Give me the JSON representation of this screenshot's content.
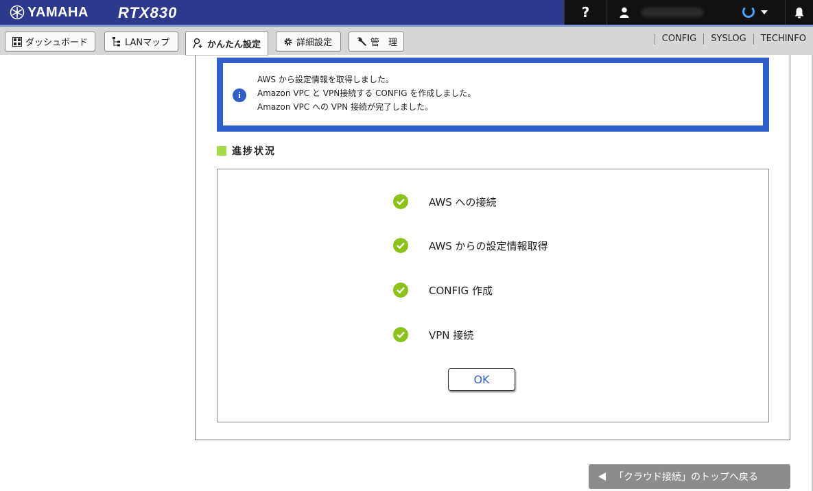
{
  "header": {
    "brand": "YAMAHA",
    "model": "RTX830",
    "help_label": "?",
    "colors": {
      "bar": "#2d3a8c",
      "right_area": "#111111"
    }
  },
  "tabs": [
    {
      "label": "ダッシュボード",
      "icon": "dashboard-icon",
      "active": false
    },
    {
      "label": "LANマップ",
      "icon": "lan-map-icon",
      "active": false
    },
    {
      "label": "かんたん設定",
      "icon": "wand-icon",
      "active": true
    },
    {
      "label": "詳細設定",
      "icon": "gear-icon",
      "active": false
    },
    {
      "label": "管　理",
      "icon": "wrench-icon",
      "active": false
    }
  ],
  "toplinks": [
    "CONFIG",
    "SYSLOG",
    "TECHINFO"
  ],
  "info": {
    "lines": [
      "AWS から設定情報を取得しました。",
      "Amazon VPC と VPN接続する CONFIG を作成しました。",
      "Amazon VPC への VPN 接続が完了しました。"
    ],
    "icon": "info-icon"
  },
  "progress": {
    "title": "進捗状況",
    "steps": [
      {
        "label": "AWS への接続",
        "status": "done"
      },
      {
        "label": "AWS からの設定情報取得",
        "status": "done"
      },
      {
        "label": "CONFIG 作成",
        "status": "done"
      },
      {
        "label": "VPN 接続",
        "status": "done"
      }
    ],
    "ok_label": "OK",
    "check_color": "#8cc21b"
  },
  "back_button": {
    "label": "「クラウド接続」のトップへ戻る"
  }
}
